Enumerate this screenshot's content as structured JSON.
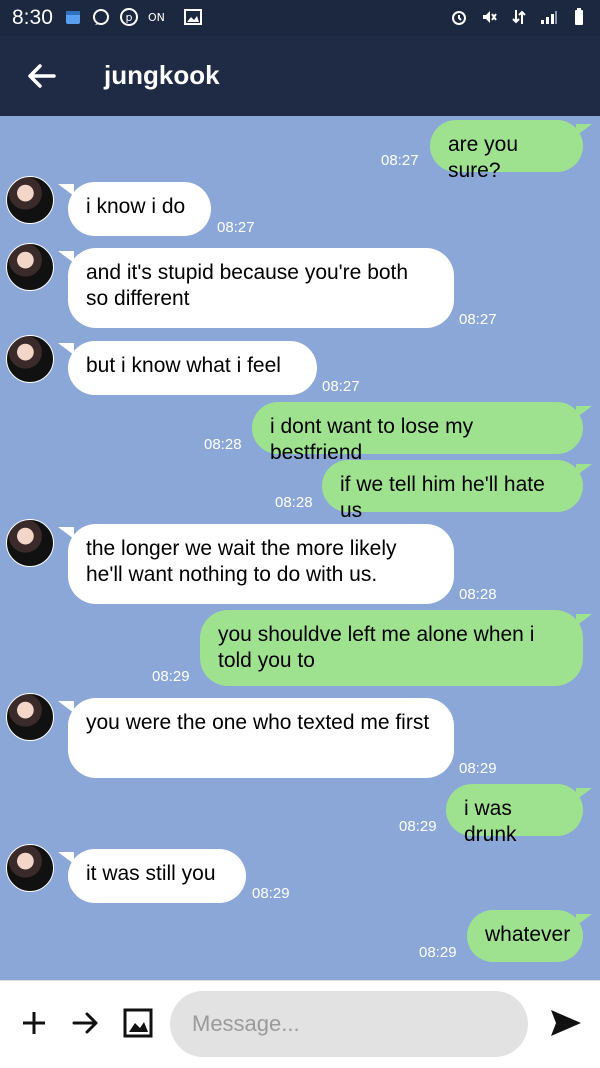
{
  "status": {
    "time": "8:30",
    "left_icons": [
      "calendar-icon",
      "whatsapp-icon",
      "pinterest-icon",
      "on-badge-icon",
      "image-icon"
    ],
    "right_icons": [
      "alarm-icon",
      "mute-icon",
      "data-icon",
      "signal-icon",
      "battery-icon"
    ]
  },
  "header": {
    "title": "jungkook"
  },
  "messages": [
    {
      "from": "me",
      "text": "are you sure?",
      "time": "08:27"
    },
    {
      "from": "them",
      "text": "i know i do",
      "time": "08:27"
    },
    {
      "from": "them",
      "text": "and it's stupid because you're both so different",
      "time": "08:27"
    },
    {
      "from": "them",
      "text": "but i know what i feel",
      "time": "08:27"
    },
    {
      "from": "me",
      "text": "i dont want to lose my bestfriend",
      "time": "08:28"
    },
    {
      "from": "me",
      "text": "if we tell him he'll hate us",
      "time": "08:28"
    },
    {
      "from": "them",
      "text": "the longer we wait the more likely he'll want nothing to do with us.",
      "time": "08:28"
    },
    {
      "from": "me",
      "text": "you shouldve left me alone when i told you to",
      "time": "08:29"
    },
    {
      "from": "them",
      "text": "you were the one who texted me first",
      "time": "08:29"
    },
    {
      "from": "me",
      "text": "i was drunk",
      "time": "08:29"
    },
    {
      "from": "them",
      "text": "it was still you",
      "time": "08:29"
    },
    {
      "from": "me",
      "text": "whatever",
      "time": "08:29"
    }
  ],
  "composer": {
    "placeholder": "Message..."
  }
}
